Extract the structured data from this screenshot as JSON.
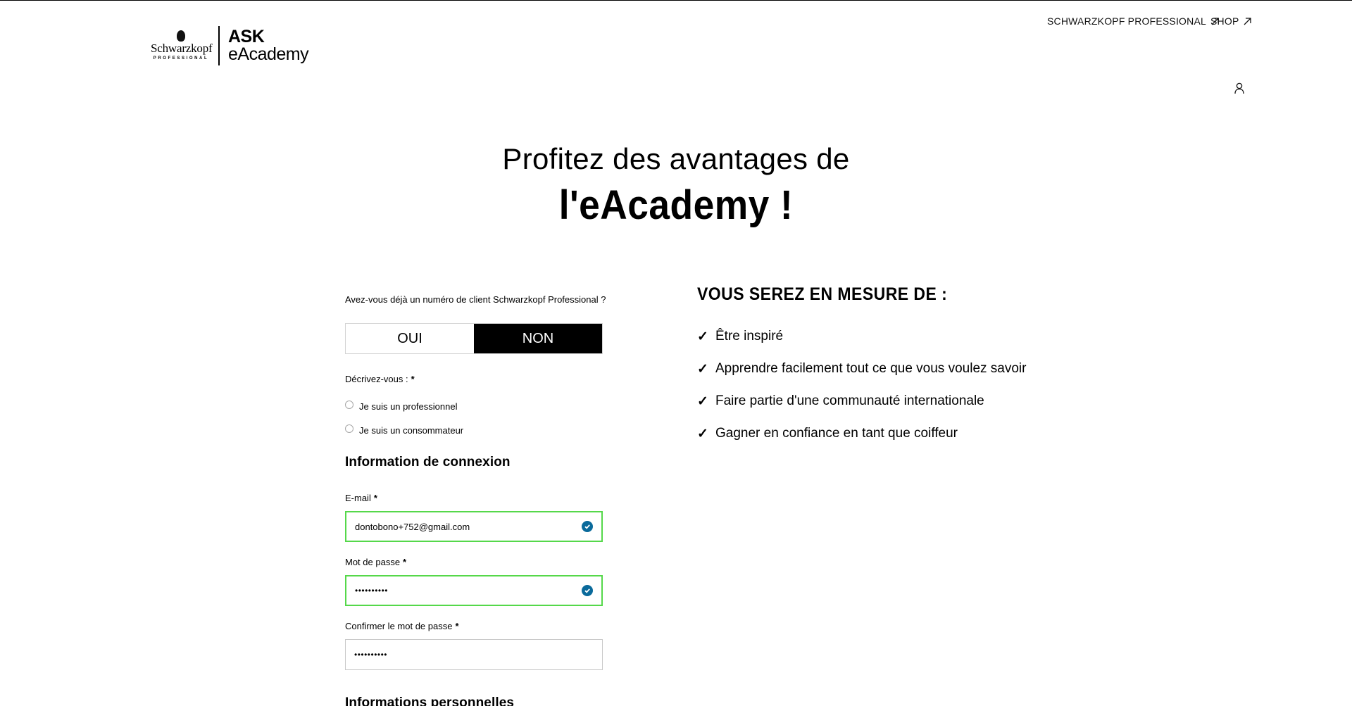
{
  "brand": {
    "name": "Schwarzkopf",
    "sub": "PROFESSIONAL",
    "product_top": "ASK",
    "product_bottom": "eAcademy"
  },
  "topnav": {
    "links": [
      {
        "label": "SCHWARZKOPF PROFESSIONAL",
        "icon": "external-arrow-icon"
      },
      {
        "label": "SHOP",
        "icon": "external-arrow-icon"
      }
    ],
    "account_icon": "user-icon"
  },
  "hero": {
    "line1": "Profitez des avantages de",
    "line2": "l'eAcademy !"
  },
  "form": {
    "question": "Avez-vous déjà un numéro de client Schwarzkopf Professional ?",
    "toggle": {
      "options": [
        "OUI",
        "NON"
      ],
      "selected": "NON"
    },
    "describe_label": "Décrivez-vous :",
    "required_mark": "*",
    "radio_options": [
      "Je suis un professionnel",
      "Je suis un consommateur"
    ],
    "section_connexion": "Information de connexion",
    "email": {
      "label": "E-mail",
      "value": "dontobono+752@gmail.com"
    },
    "password": {
      "label": "Mot de passe",
      "value": "••••••••••"
    },
    "confirm": {
      "label": "Confirmer le mot de passe",
      "value": "••••••••••"
    },
    "section_perso": "Informations personnelles"
  },
  "benefits": {
    "title": "VOUS SEREZ EN MESURE DE :",
    "check_glyph": "✓",
    "items": [
      "Être inspiré",
      "Apprendre facilement tout ce que vous voulez savoir",
      "Faire partie d'une communauté internationale",
      "Gagner en confiance en tant que coiffeur"
    ]
  },
  "colors": {
    "valid_border": "#55d84a",
    "valid_check": "#0a6a9b",
    "toggle_active_bg": "#000000"
  }
}
